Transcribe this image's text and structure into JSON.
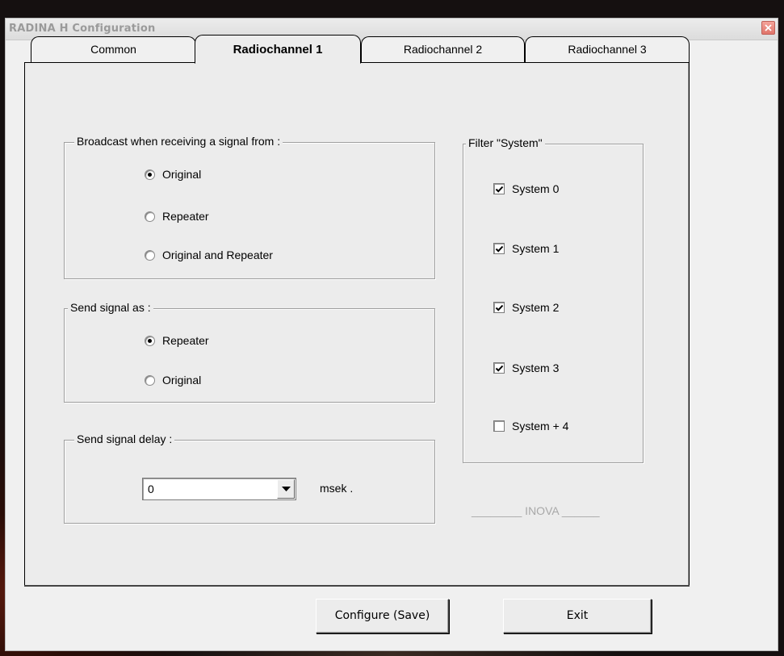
{
  "window": {
    "title": "RADINA H Configuration"
  },
  "tabs": [
    {
      "label": "Common",
      "active": false
    },
    {
      "label": "Radiochannel 1",
      "active": true
    },
    {
      "label": "Radiochannel 2",
      "active": false
    },
    {
      "label": "Radiochannel 3",
      "active": false
    }
  ],
  "broadcast_group": {
    "title": "Broadcast when receiving a signal from :",
    "options": [
      {
        "label": "Original",
        "checked": true
      },
      {
        "label": "Repeater",
        "checked": false
      },
      {
        "label": "Original and Repeater",
        "checked": false
      }
    ]
  },
  "send_as_group": {
    "title": "Send signal as :",
    "options": [
      {
        "label": "Repeater",
        "checked": true
      },
      {
        "label": "Original",
        "checked": false
      }
    ]
  },
  "delay_group": {
    "title": "Send signal delay :",
    "value": "0",
    "unit": "msek ."
  },
  "filter_group": {
    "title": "Filter \"System\"",
    "items": [
      {
        "label": "System  0",
        "checked": true
      },
      {
        "label": "System  1",
        "checked": true
      },
      {
        "label": "System  2",
        "checked": true
      },
      {
        "label": "System  3",
        "checked": true
      },
      {
        "label": "System  + 4",
        "checked": false
      }
    ]
  },
  "brand": "________ INOVA ______",
  "buttons": {
    "save": "Configure (Save)",
    "exit": "Exit"
  },
  "colors": {
    "title_text": "#9a9a9a",
    "window_bg": "#f0f0f0",
    "close_button": "#e0746a"
  },
  "icons": {
    "close": "close-icon",
    "dropdown": "chevron-down-icon",
    "check": "checkmark-icon"
  }
}
